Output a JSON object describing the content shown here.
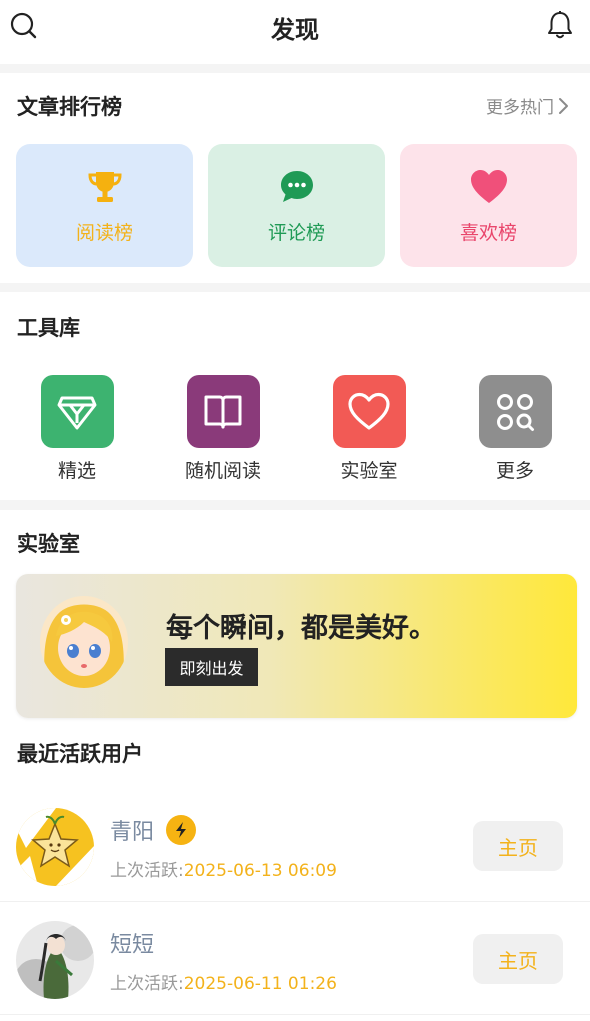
{
  "header": {
    "title": "发现"
  },
  "rankings": {
    "title": "文章排行榜",
    "more_label": "更多热门",
    "cards": [
      {
        "label": "阅读榜",
        "icon": "trophy-icon"
      },
      {
        "label": "评论榜",
        "icon": "chat-bubble-icon"
      },
      {
        "label": "喜欢榜",
        "icon": "heart-icon"
      }
    ]
  },
  "tools": {
    "title": "工具库",
    "items": [
      {
        "label": "精选",
        "icon": "diamond-icon",
        "color": "#3db370"
      },
      {
        "label": "随机阅读",
        "icon": "open-book-icon",
        "color": "#8a3a7a"
      },
      {
        "label": "实验室",
        "icon": "heart-outline-icon",
        "color": "#f25a55"
      },
      {
        "label": "更多",
        "icon": "grid-search-icon",
        "color": "#8e8e8e"
      }
    ]
  },
  "lab": {
    "title": "实验室",
    "slogan": "每个瞬间，都是美好。",
    "button": "即刻出发"
  },
  "active_users": {
    "title": "最近活跃用户",
    "active_prefix": "上次活跃:",
    "home_label": "主页",
    "users": [
      {
        "name": "青阳",
        "time": "2025-06-13 06:09",
        "has_badge": true
      },
      {
        "name": "短短",
        "time": "2025-06-11 01:26",
        "has_badge": false
      }
    ]
  },
  "colors": {
    "accent": "#f3b21b",
    "green": "#1f9a55",
    "pink": "#e9456b"
  }
}
